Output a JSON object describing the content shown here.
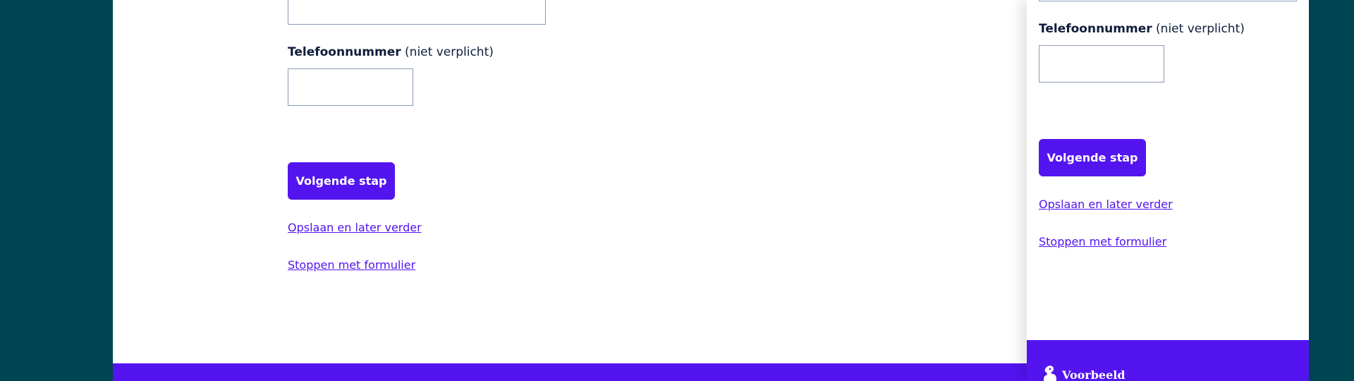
{
  "form": {
    "phone_label": "Telefoonnummer",
    "phone_optional": "(niet verplicht)",
    "phone_value": "",
    "next_button": "Volgende stap",
    "save_link": "Opslaan en later verder",
    "stop_link": "Stoppen met formulier"
  },
  "footer": {
    "logo_text": "Voorbeeld"
  },
  "colors": {
    "background": "#004554",
    "accent": "#5314f0",
    "input_border": "#8a9bb5",
    "label": "#0f1d3a"
  }
}
